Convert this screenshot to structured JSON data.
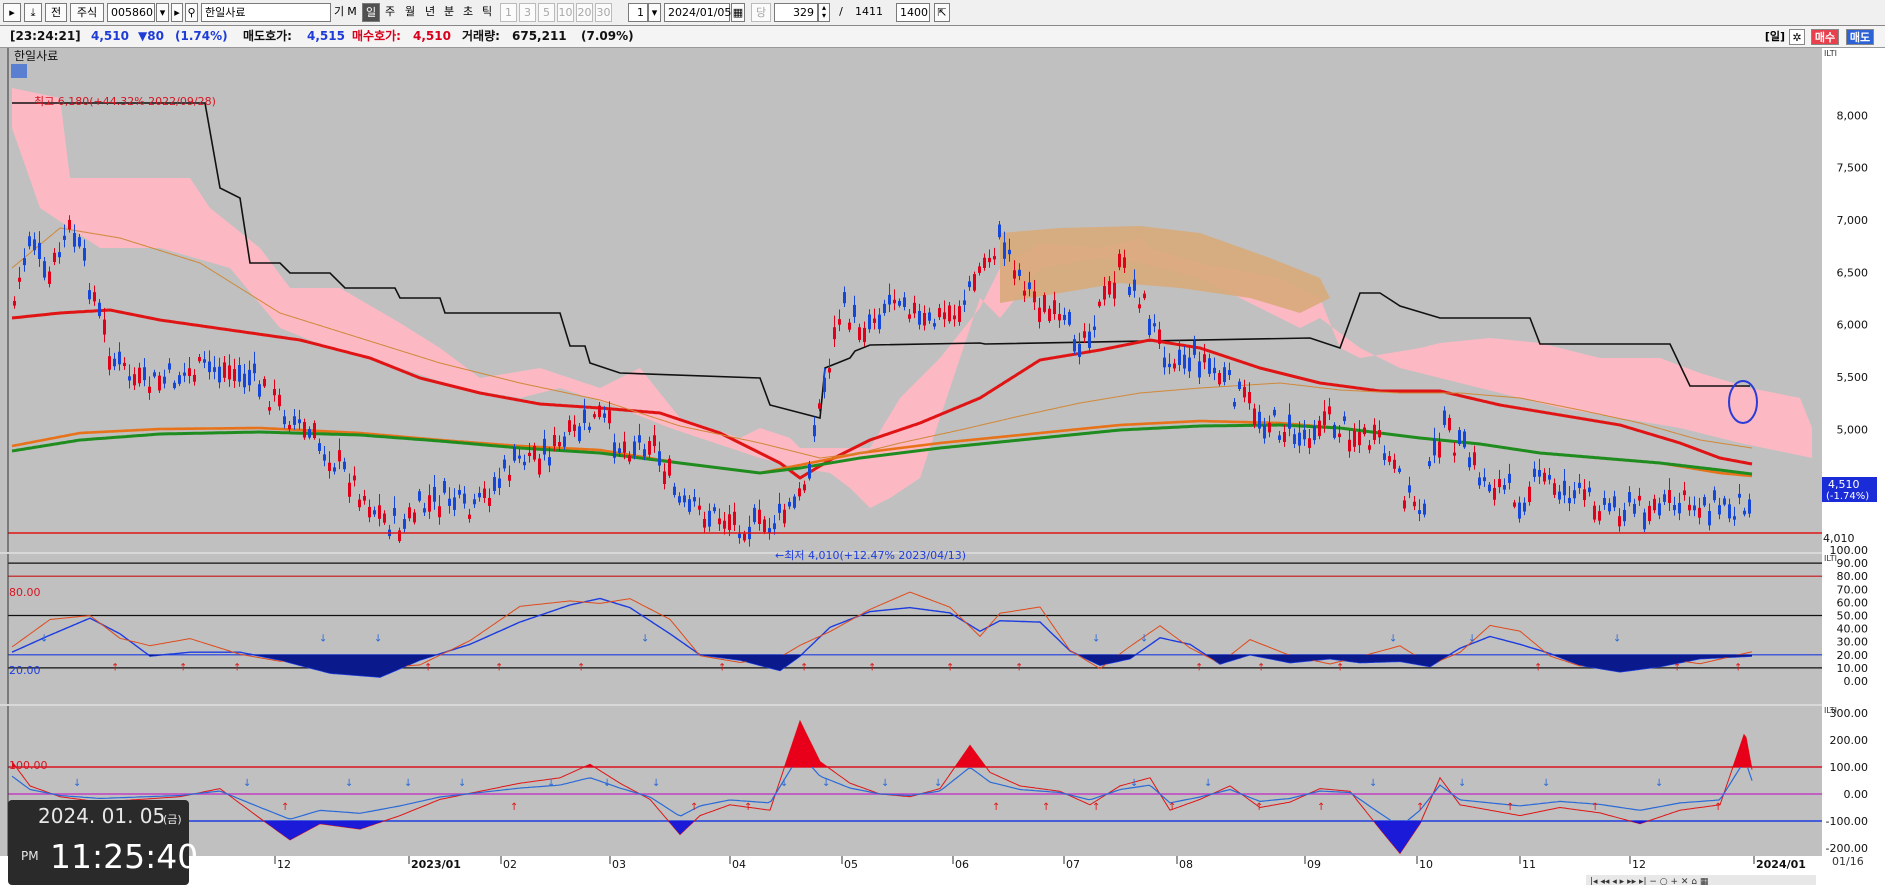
{
  "toolbar": {
    "btn_prev": "전",
    "market": "주식",
    "code": "005860",
    "name": "한일사료",
    "period_labels": [
      "기",
      "M",
      "일",
      "주",
      "월",
      "년",
      "분",
      "초",
      "틱"
    ],
    "interval_labels": [
      "1",
      "3",
      "5",
      "10",
      "20",
      "30"
    ],
    "interval_value": "1",
    "date": "2024/01/05",
    "count_label": "당",
    "count": "329",
    "sep": "/",
    "total": "1411",
    "zoom": "1400"
  },
  "info": {
    "time": "[23:24:21]",
    "price": "4,510",
    "change": "▼80",
    "change_pct": "(1.74%)",
    "ask_label": "매도호가:",
    "ask": "4,515",
    "bid_label": "매수호가:",
    "bid": "4,510",
    "vol_label": "거래량:",
    "volume": "675,211",
    "vol_pct": "(7.09%)",
    "period_btn": "[일]",
    "buy_btn": "매수",
    "sell_btn": "매도"
  },
  "chart": {
    "stock_name": "한일사료",
    "high_text": "최고 6,180(+44.32% 2022/09/28)",
    "low_text": "←최저 4,010(+12.47% 2023/04/13)",
    "current_price": "4,510",
    "current_change": "(-1.74%)",
    "low_marker": "4,010",
    "osc1_upper": "80.00",
    "osc1_lower": "20.00",
    "osc2_upper": "100.00",
    "price_axis": [
      "8,000",
      "7,500",
      "7,000",
      "6,500",
      "6,000",
      "5,500",
      "5,000"
    ],
    "osc1_axis": [
      "100.00",
      "90.00",
      "80.00",
      "70.00",
      "60.00",
      "50.00",
      "40.00",
      "30.00",
      "20.00",
      "10.00",
      "0.00"
    ],
    "osc2_axis": [
      "300.00",
      "200.00",
      "100.00",
      "0.00",
      "-100.00",
      "-200.00"
    ],
    "x_axis": [
      "12",
      "2023/01",
      "02",
      "03",
      "04",
      "05",
      "06",
      "07",
      "08",
      "09",
      "10",
      "11",
      "12",
      "2024/01"
    ],
    "page_indicator": "01/16",
    "colors": {
      "up": "#e0001a",
      "down": "#1446d8",
      "ma_red": "#e01414",
      "ma_green": "#1e8c1e",
      "cloud": "#ffb6c1"
    }
  },
  "chart_data": {
    "type": "candlestick",
    "price_ylim": [
      4010,
      8180
    ],
    "osc1_ylim": [
      0,
      100
    ],
    "osc2_ylim": [
      -200,
      300
    ],
    "last_close": 4510,
    "change": -80,
    "change_pct": -1.74
  },
  "clock": {
    "date": "2024. 01. 05",
    "day": "(금)",
    "ampm": "PM",
    "time": "11:25:40"
  }
}
